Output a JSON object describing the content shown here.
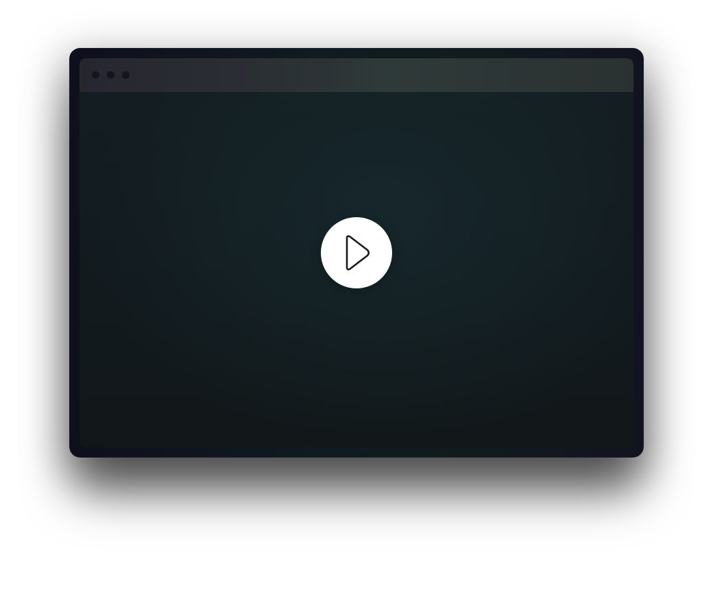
{
  "window": {
    "controls": [
      {
        "name": "window-control-1"
      },
      {
        "name": "window-control-2"
      },
      {
        "name": "window-control-3"
      }
    ]
  },
  "player": {
    "play_icon": "play-icon",
    "button_color": "#ffffff",
    "icon_color": "#1a1a1a"
  },
  "colors": {
    "frame": "#10161c",
    "titlebar": "#2b3233",
    "content": "#141d21"
  }
}
